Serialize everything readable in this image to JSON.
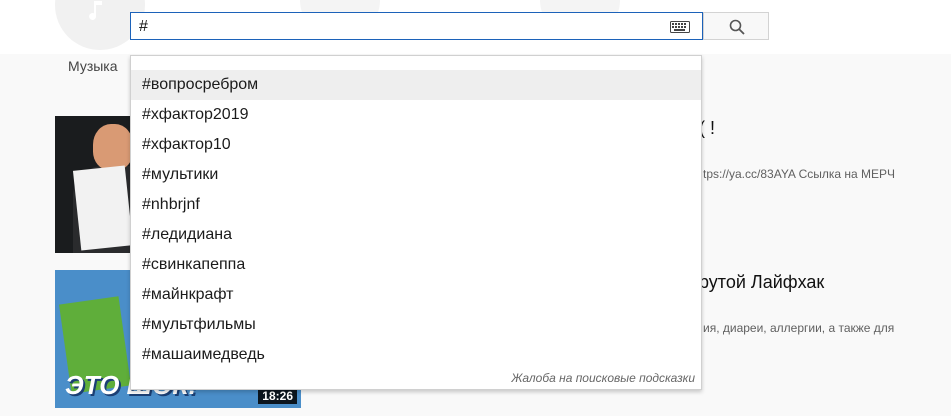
{
  "header": {
    "search_value": "#",
    "icons": [
      "music-icon",
      "keyboard-icon",
      "search-icon"
    ]
  },
  "tabs": {
    "music": "Музыка"
  },
  "videos": [
    {
      "title_partial": "( !",
      "desc_partial": "tps://ya.cc/83AYA Ссылка на МЕРЧ"
    },
    {
      "title_partial": "рутой Лайфхак",
      "desc_partial": "ия, диареи, аллергии, а также для",
      "thumb_text": "ЭТО ШОК!",
      "duration": "18:26"
    }
  ],
  "suggestions": {
    "items": [
      "#вопросребром",
      "#хфактор2019",
      "#хфактор10",
      "#мультики",
      "#nhbrjnf",
      "#ледидиана",
      "#свинкапеппа",
      "#майнкрафт",
      "#мультфильмы",
      "#машаимедведь"
    ],
    "active_index": 0,
    "report_label": "Жалоба на поисковые подсказки"
  },
  "colors": {
    "search_border": "#1c62b9",
    "active_item_bg": "#eeeeee",
    "page_bg": "#f9f9f9"
  }
}
